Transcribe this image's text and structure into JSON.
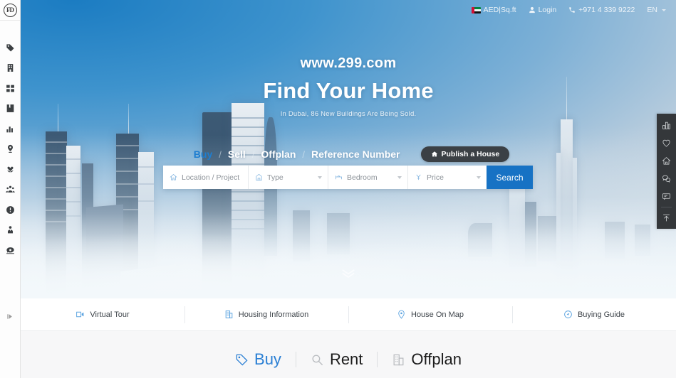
{
  "brand": {
    "logo_text": "FD",
    "accent_color": "#1772c4",
    "dark_color": "#3b4045"
  },
  "sidebar": {
    "items": [
      {
        "name": "tag-icon",
        "label": "Buy"
      },
      {
        "name": "building-icon",
        "label": "Buildings"
      },
      {
        "name": "grid-icon",
        "label": "Categories"
      },
      {
        "name": "book-icon",
        "label": "Listings"
      },
      {
        "name": "bar-chart-icon",
        "label": "Statistics"
      },
      {
        "name": "map-pin-icon",
        "label": "Map"
      },
      {
        "name": "hands-heart-icon",
        "label": "Favorites"
      },
      {
        "name": "people-icon",
        "label": "Community"
      },
      {
        "name": "info-icon",
        "label": "Information"
      },
      {
        "name": "agent-icon",
        "label": "Agents"
      },
      {
        "name": "telephone-icon",
        "label": "Contact"
      }
    ],
    "toggle_label": "Expand sidebar"
  },
  "topbar": {
    "currency": "AED|Sq.ft",
    "login": "Login",
    "phone": "+971 4 339 9222",
    "language": "EN"
  },
  "hero": {
    "url": "www.299.com",
    "title": "Find Your Home",
    "subtitle": "In Dubai, 86 New Buildings Are Being Sold."
  },
  "tabs": {
    "items": [
      {
        "label": "Buy",
        "active": true
      },
      {
        "label": "Sell",
        "active": false
      },
      {
        "label": "Offplan",
        "active": false
      },
      {
        "label": "Reference Number",
        "active": false
      }
    ],
    "separator": "/",
    "publish_label": "Publish a House"
  },
  "search": {
    "location_placeholder": "Location / Project",
    "type_label": "Type",
    "bedroom_label": "Bedroom",
    "price_label": "Price",
    "search_button": "Search"
  },
  "features": [
    {
      "label": "Virtual Tour",
      "icon": "virtual-tour-icon"
    },
    {
      "label": "Housing Information",
      "icon": "housing-information-icon"
    },
    {
      "label": "House On Map",
      "icon": "map-marker-icon"
    },
    {
      "label": "Buying Guide",
      "icon": "compass-icon"
    }
  ],
  "bottom_tabs": [
    {
      "label": "Buy",
      "icon": "tag-icon",
      "active": true
    },
    {
      "label": "Rent",
      "icon": "magnifier-icon",
      "active": false
    },
    {
      "label": "Offplan",
      "icon": "building-icon",
      "active": false
    }
  ],
  "right_toolbar": [
    {
      "name": "chart-icon",
      "label": "Market Data"
    },
    {
      "name": "heart-icon",
      "label": "Favorites"
    },
    {
      "name": "home-icon",
      "label": "Home"
    },
    {
      "name": "wechat-icon",
      "label": "WeChat"
    },
    {
      "name": "message-icon",
      "label": "Message"
    },
    {
      "name": "scroll-top-icon",
      "label": "Back To Top"
    }
  ]
}
